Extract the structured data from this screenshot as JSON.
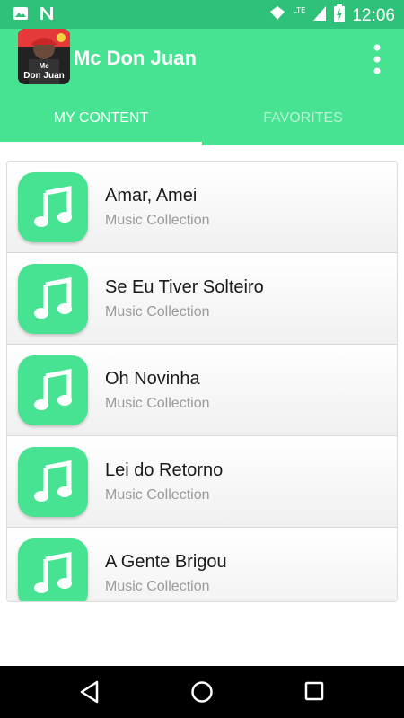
{
  "status_bar": {
    "time": "12:06",
    "network": "LTE"
  },
  "app_bar": {
    "title": "Mc Don Juan",
    "logo_text_top": "Mc",
    "logo_text_bottom": "Don Juan"
  },
  "tabs": [
    {
      "label": "MY CONTENT",
      "active": true
    },
    {
      "label": "FAVORITES",
      "active": false
    }
  ],
  "list_items": [
    {
      "title": "Amar, Amei",
      "subtitle": "Music Collection",
      "icon": "music-note-icon"
    },
    {
      "title": "Se Eu Tiver Solteiro",
      "subtitle": "Music Collection",
      "icon": "music-note-icon"
    },
    {
      "title": "Oh Novinha",
      "subtitle": "Music Collection",
      "icon": "music-note-icon"
    },
    {
      "title": "Lei do Retorno",
      "subtitle": "Music Collection",
      "icon": "music-note-icon"
    },
    {
      "title": "A Gente Brigou",
      "subtitle": "Music Collection",
      "icon": "music-note-icon"
    }
  ],
  "colors": {
    "status_bar": "#2fc17a",
    "app_bar": "#47e292",
    "accent": "#47e292"
  }
}
